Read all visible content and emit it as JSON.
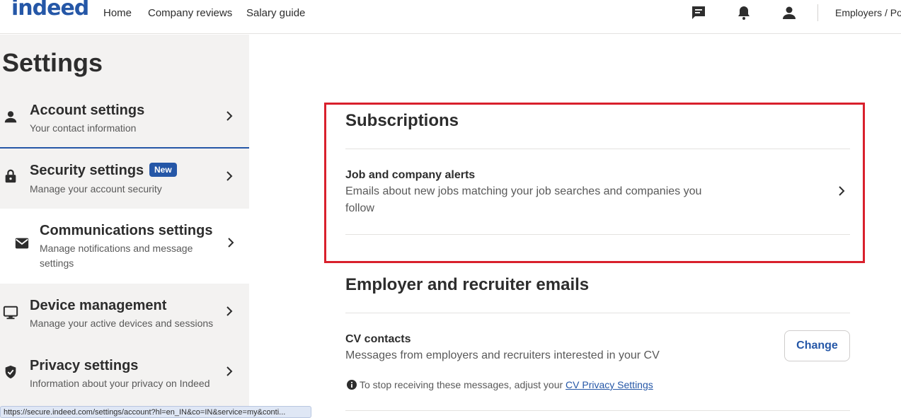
{
  "header": {
    "logo": "indeed",
    "nav": [
      "Home",
      "Company reviews",
      "Salary guide"
    ],
    "employers": "Employers / Po"
  },
  "sidebar": {
    "title": "Settings",
    "items": [
      {
        "title": "Account settings",
        "subtitle": "Your contact information",
        "icon": "person-icon"
      },
      {
        "title": "Security settings",
        "badge": "New",
        "subtitle": "Manage your account security",
        "icon": "lock-icon"
      },
      {
        "title": "Communications settings",
        "subtitle": "Manage notifications and message settings",
        "icon": "mail-icon"
      },
      {
        "title": "Device management",
        "subtitle": "Manage your active devices and sessions",
        "icon": "monitor-icon"
      },
      {
        "title": "Privacy settings",
        "subtitle": "Information about your privacy on Indeed",
        "icon": "shield-icon"
      }
    ]
  },
  "main": {
    "subscriptions": {
      "heading": "Subscriptions",
      "row_title": "Job and company alerts",
      "row_desc": "Emails about new jobs matching your job searches and companies you follow"
    },
    "employer_emails": {
      "heading": "Employer and recruiter emails",
      "row_title": "CV contacts",
      "row_desc": "Messages from employers and recruiters interested in your CV",
      "change_label": "Change",
      "info_text": "To stop receiving these messages, adjust your",
      "info_link": "CV Privacy Settings"
    }
  },
  "statusbar": {
    "url": "https://secure.indeed.com/settings/account?hl=en_IN&co=IN&service=my&conti..."
  },
  "colors": {
    "brand": "#2557a7",
    "highlight": "#d9202c",
    "sidebar_bg": "#f3f2f1"
  }
}
